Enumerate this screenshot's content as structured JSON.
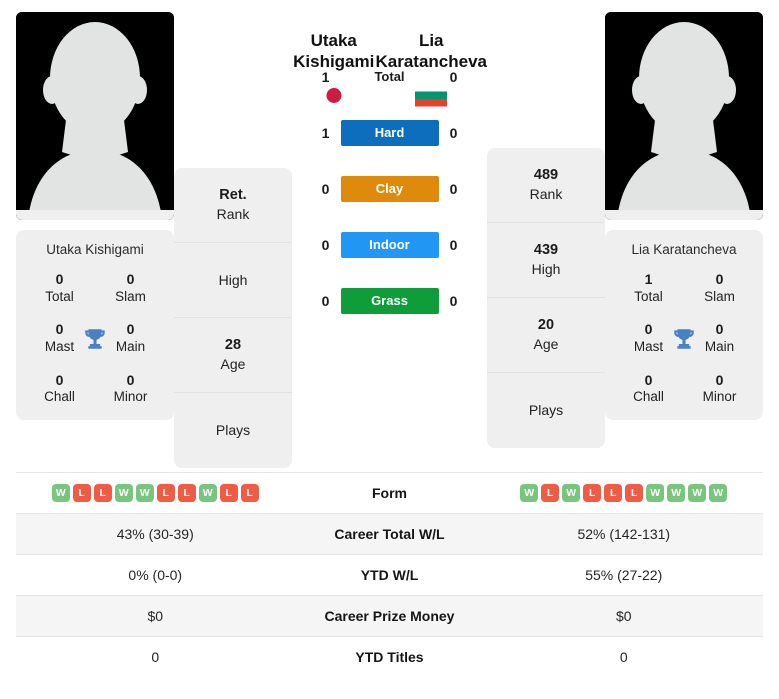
{
  "left_player": {
    "name_line1": "Utaka",
    "name_line2": "Kishigami",
    "full_name": "Utaka Kishigami",
    "flag": "japan-flag",
    "avatar": "player-photo-placeholder",
    "trophies": [
      {
        "value": "0",
        "label": "Total"
      },
      {
        "value": "0",
        "label": "Slam"
      },
      {
        "value": "0",
        "label": "Mast"
      },
      {
        "value": "0",
        "label": "Main"
      },
      {
        "value": "0",
        "label": "Chall"
      },
      {
        "value": "0",
        "label": "Minor"
      }
    ],
    "stats": [
      {
        "value": "Ret.",
        "label": "Rank"
      },
      {
        "value": "",
        "label": "High"
      },
      {
        "value": "28",
        "label": "Age"
      },
      {
        "value": "",
        "label": "Plays"
      }
    ],
    "form": [
      "W",
      "L",
      "L",
      "W",
      "W",
      "L",
      "L",
      "W",
      "L",
      "L"
    ]
  },
  "right_player": {
    "name_line1": "Lia",
    "name_line2": "Karatancheva",
    "full_name": "Lia Karatancheva",
    "flag": "bulgaria-flag",
    "avatar": "player-photo-placeholder",
    "trophies": [
      {
        "value": "1",
        "label": "Total"
      },
      {
        "value": "0",
        "label": "Slam"
      },
      {
        "value": "0",
        "label": "Mast"
      },
      {
        "value": "0",
        "label": "Main"
      },
      {
        "value": "0",
        "label": "Chall"
      },
      {
        "value": "0",
        "label": "Minor"
      }
    ],
    "stats": [
      {
        "value": "489",
        "label": "Rank"
      },
      {
        "value": "439",
        "label": "High"
      },
      {
        "value": "20",
        "label": "Age"
      },
      {
        "value": "",
        "label": "Plays"
      }
    ],
    "form": [
      "W",
      "L",
      "W",
      "L",
      "L",
      "L",
      "W",
      "W",
      "W",
      "W"
    ]
  },
  "head_to_head": [
    {
      "label": "Total",
      "left": "1",
      "right": "0",
      "color": "",
      "style": "plain"
    },
    {
      "label": "Hard",
      "left": "1",
      "right": "0",
      "color": "#0d6ebd",
      "style": "badge"
    },
    {
      "label": "Clay",
      "left": "0",
      "right": "0",
      "color": "#e08a0b",
      "style": "badge"
    },
    {
      "label": "Indoor",
      "left": "0",
      "right": "0",
      "color": "#2196f3",
      "style": "badge"
    },
    {
      "label": "Grass",
      "left": "0",
      "right": "0",
      "color": "#0f9d3a",
      "style": "badge"
    }
  ],
  "table_rows": [
    {
      "label": "Form",
      "left": "",
      "right": "",
      "type": "form"
    },
    {
      "label": "Career Total W/L",
      "left": "43% (30-39)",
      "right": "52% (142-131)",
      "type": "text"
    },
    {
      "label": "YTD W/L",
      "left": "0% (0-0)",
      "right": "55% (27-22)",
      "type": "text"
    },
    {
      "label": "Career Prize Money",
      "left": "$0",
      "right": "$0",
      "type": "text"
    },
    {
      "label": "YTD Titles",
      "left": "0",
      "right": "0",
      "type": "text"
    }
  ],
  "colors": {
    "win": "#78c57e",
    "loss": "#f05b45",
    "card_bg": "#efefef",
    "trophy": "#4a7fc1",
    "japan_red": "#cf1b3f",
    "bulgaria_green": "#00966e",
    "bulgaria_red": "#e8412b"
  }
}
